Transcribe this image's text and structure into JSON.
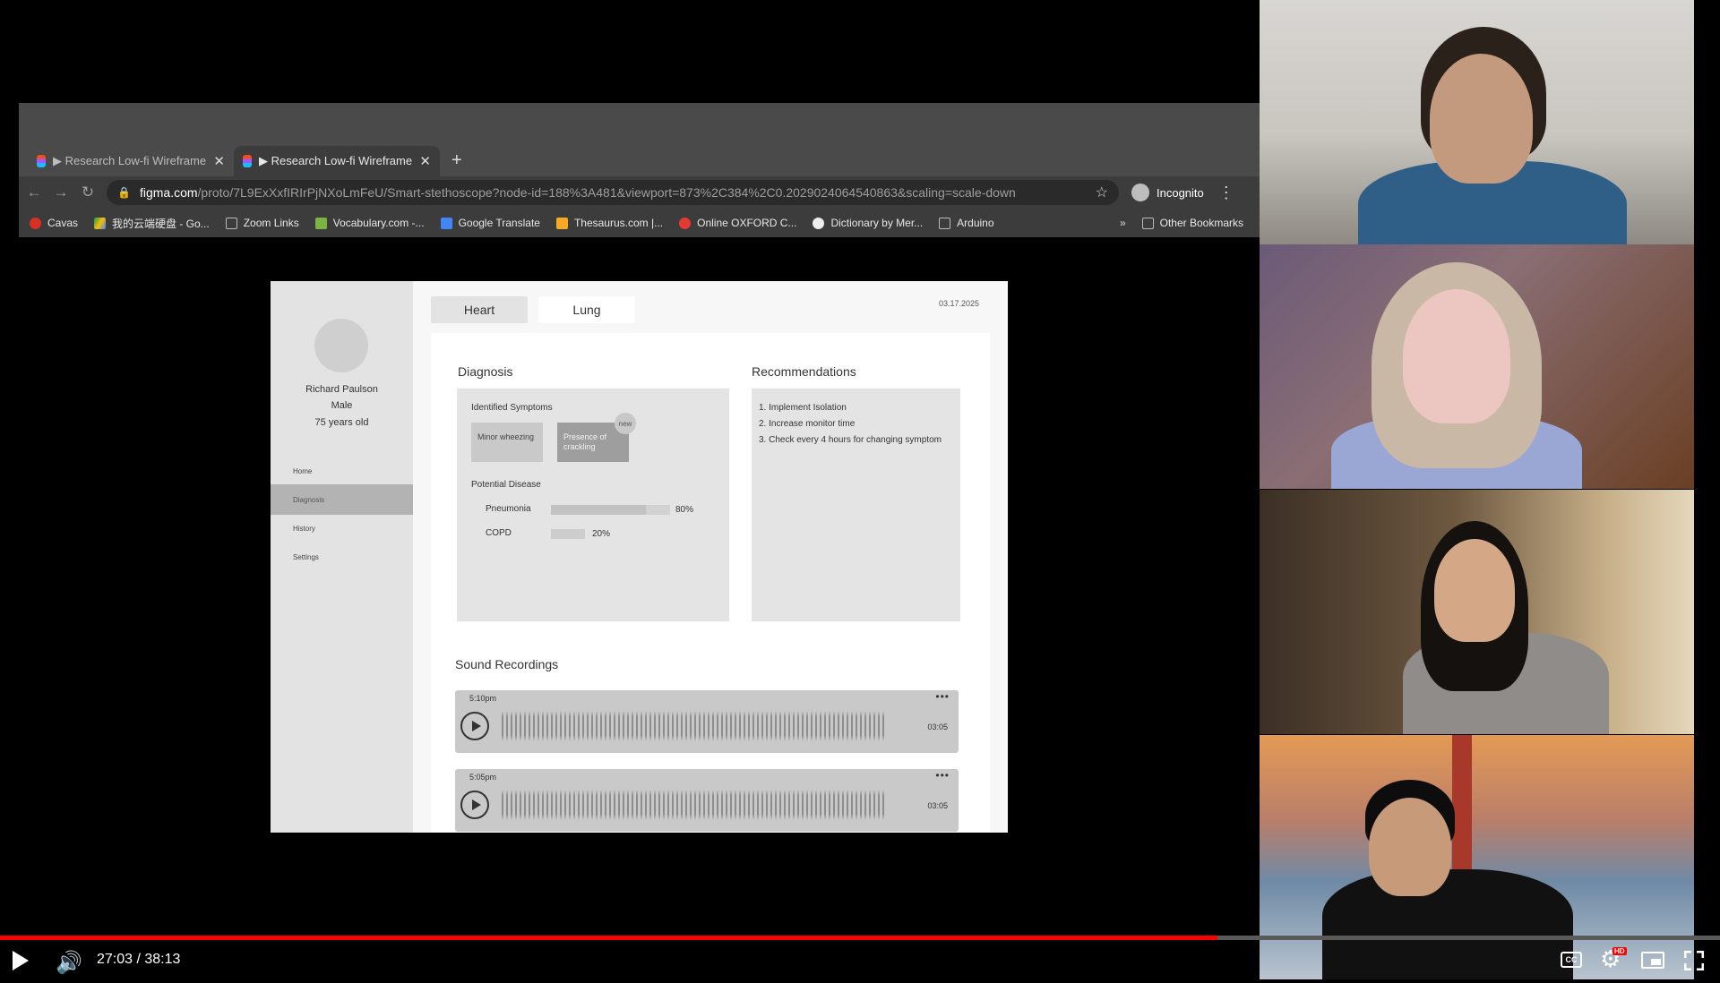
{
  "browser": {
    "tabs": [
      {
        "label": "▶ Research Low-fi Wireframes",
        "active": false
      },
      {
        "label": "▶ Research Low-fi Wireframes",
        "active": true
      }
    ],
    "new_tab": "+",
    "url_host": "figma.com",
    "url_path": "/proto/7L9ExXxfIRIrPjNXoLmFeU/Smart-stethoscope?node-id=188%3A481&viewport=873%2C384%2C0.2029024064540863&scaling=scale-down",
    "incognito_label": "Incognito",
    "bookmarks": [
      {
        "label": "Cavas",
        "icon": "cavas-icon",
        "color": "#d93025"
      },
      {
        "label": "我的云端硬盘 - Go...",
        "icon": "google-drive-icon",
        "color": "#fbbc04"
      },
      {
        "label": "Zoom Links",
        "icon": "folder-icon",
        "color": "#9e9e9e"
      },
      {
        "label": "Vocabulary.com -...",
        "icon": "vocabulary-icon",
        "color": "#7cb342"
      },
      {
        "label": "Google Translate",
        "icon": "translate-icon",
        "color": "#4285f4"
      },
      {
        "label": "Thesaurus.com |...",
        "icon": "thesaurus-icon",
        "color": "#f9a825"
      },
      {
        "label": "Online OXFORD C...",
        "icon": "oxford-icon",
        "color": "#e53935"
      },
      {
        "label": "Dictionary by Mer...",
        "icon": "dictionary-icon",
        "color": "#eeeeee"
      },
      {
        "label": "Arduino",
        "icon": "folder-icon",
        "color": "#9e9e9e"
      }
    ],
    "more_bookmarks": "»",
    "other_bookmarks": "Other Bookmarks"
  },
  "wireframe": {
    "patient": {
      "name": "Richard Paulson",
      "sex": "Male",
      "age": "75 years old"
    },
    "nav": [
      {
        "label": "Home",
        "selected": false
      },
      {
        "label": "Diagnosis",
        "selected": true
      },
      {
        "label": "History",
        "selected": false
      },
      {
        "label": "Settings",
        "selected": false
      }
    ],
    "tabs": {
      "heart": "Heart",
      "lung": "Lung"
    },
    "date": "03.17.2025",
    "diagnosis": {
      "title": "Diagnosis",
      "symptoms_label": "Identified Symptoms",
      "symptom_1": "Minor wheezing",
      "symptom_2": "Presence of crackling",
      "new_badge": "new",
      "potential_label": "Potential Disease",
      "diseases": [
        {
          "name": "Pneumonia",
          "pct_label": "80%",
          "fraction": 0.8
        },
        {
          "name": "COPD",
          "pct_label": "20%",
          "fraction": 0.2
        }
      ]
    },
    "recommendations": {
      "title": "Recommendations",
      "items": [
        "1. Implement Isolation",
        "2. Increase monitor time",
        "3. Check every 4 hours for changing symptom"
      ]
    },
    "recordings": {
      "title": "Sound Recordings",
      "items": [
        {
          "time": "5:10pm",
          "duration": "03:05",
          "menu": "•••"
        },
        {
          "time": "5:05pm",
          "duration": "03:05",
          "menu": "•••"
        }
      ]
    }
  },
  "player": {
    "current_time": "27:03",
    "duration": "38:13",
    "time_label": "27:03 / 38:13",
    "progress": 0.708,
    "cc_label": "CC",
    "hd_label": "HD",
    "accent": "#ff0000"
  },
  "participants": [
    {
      "position": 1,
      "description": "woman in blue shirt"
    },
    {
      "position": 2,
      "description": "smiling woman with long hair"
    },
    {
      "position": 3,
      "description": "woman with earphones"
    },
    {
      "position": 4,
      "description": "man with glasses, Golden Gate background"
    }
  ]
}
